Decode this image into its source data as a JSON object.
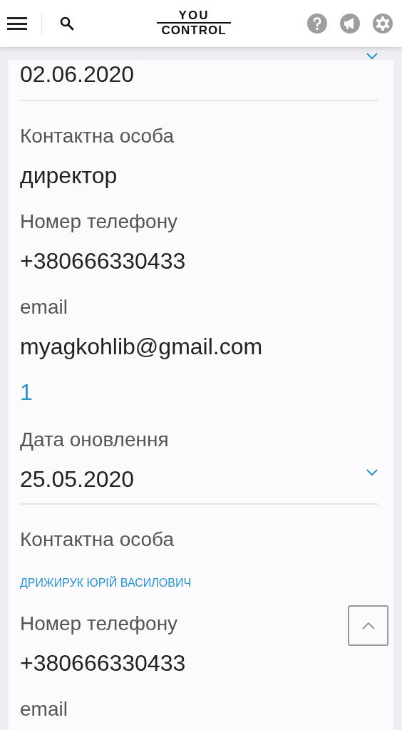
{
  "header": {
    "logo_top": "YOU",
    "logo_bottom": "CONTROL"
  },
  "blocks": [
    {
      "kind": "date",
      "value": "02.06.2020"
    },
    {
      "kind": "field",
      "label": "Контактна особа",
      "value": "директор"
    },
    {
      "kind": "field",
      "label": "Номер телефону",
      "value": "+380666330433"
    },
    {
      "kind": "field",
      "label": "email",
      "value": "myagkohlib@gmail.com"
    },
    {
      "kind": "index",
      "value": "1"
    },
    {
      "kind": "date",
      "label": "Дата оновлення",
      "value": "25.05.2020"
    },
    {
      "kind": "link",
      "label": "Контактна особа",
      "value": "ДРИЖИРУК ЮРІЙ ВАСИЛОВИЧ"
    },
    {
      "kind": "field",
      "label": "Номер телефону",
      "value": "+380666330433"
    },
    {
      "kind": "field",
      "label": "email"
    }
  ]
}
